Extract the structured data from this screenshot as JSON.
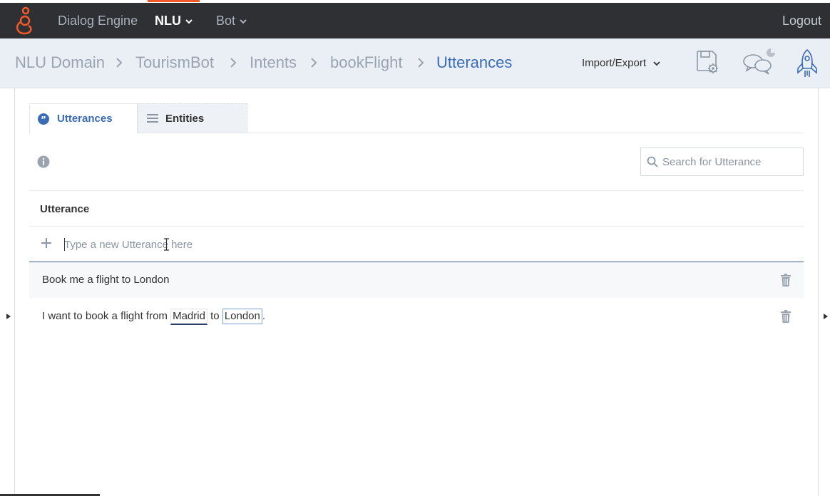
{
  "topnav": {
    "items": [
      "Dialog Engine",
      "NLU",
      "Bot"
    ],
    "active": "NLU",
    "logout": "Logout",
    "brand_color": "#f15a29"
  },
  "breadcrumb": {
    "items": [
      "NLU Domain",
      "TourismBot",
      "Intents",
      "bookFlight",
      "Utterances"
    ],
    "current": "Utterances"
  },
  "toolbar": {
    "import_export": "Import/Export",
    "icons": [
      "save-settings-icon",
      "chat-bubbles-icon",
      "rocket-icon"
    ]
  },
  "tabs": [
    {
      "label": "Utterances",
      "icon": "quote-icon",
      "active": true
    },
    {
      "label": "Entities",
      "icon": "list-icon",
      "active": false
    }
  ],
  "search": {
    "placeholder": "Search for Utterance"
  },
  "table": {
    "header": "Utterance",
    "new_placeholder": "Type a new Utterance here",
    "rows": [
      {
        "text": "Book me a flight to London"
      },
      {
        "before": "I want to book a flight from ",
        "entity1": "Madrid",
        "middle": " to ",
        "entity2": "London",
        "after": "."
      }
    ]
  },
  "colors": {
    "accent": "#3a6cb4",
    "nav_bg": "#2e3033",
    "crumb_bg": "#eaeff5"
  }
}
